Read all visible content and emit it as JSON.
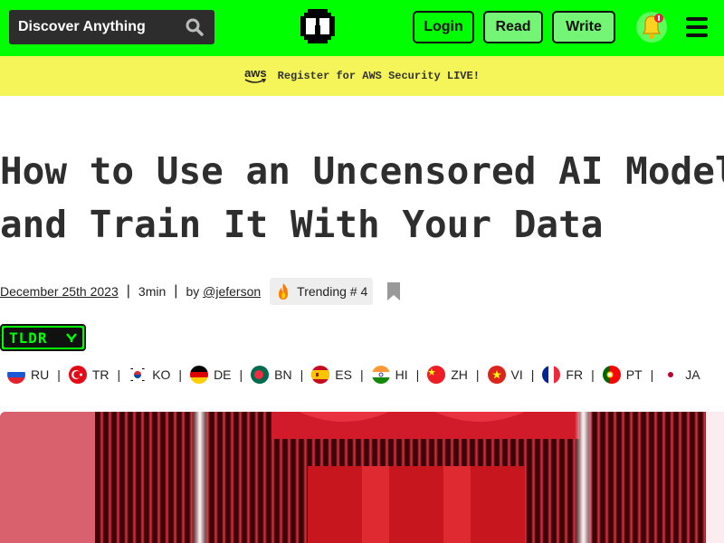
{
  "header": {
    "search_label": "Discover Anything",
    "search_icon": "search-icon",
    "logo_icon": "hackernoon-logo-icon",
    "login_label": "Login",
    "read_label": "Read",
    "write_label": "Write",
    "bell_icon": "bell-icon",
    "menu_icon": "menu-icon",
    "accent_color": "#00ff00"
  },
  "banner": {
    "brand": "aws",
    "text": "Register for AWS Security LIVE!",
    "color": "#f5f55a"
  },
  "article": {
    "title_line1": "How to Use an Uncensored AI Model",
    "title_line2": "and Train It With Your Data",
    "date": "December 25th 2023",
    "read_time": "3min",
    "by_prefix": "by",
    "author": "@jeferson",
    "trending": "Trending # 4",
    "tldr_label": "TLDR",
    "tldr_chevron": "chevron-down-icon"
  },
  "languages": [
    {
      "code": "RU",
      "flag": "russia-flag-icon"
    },
    {
      "code": "TR",
      "flag": "turkey-flag-icon"
    },
    {
      "code": "KO",
      "flag": "korea-flag-icon"
    },
    {
      "code": "DE",
      "flag": "germany-flag-icon"
    },
    {
      "code": "BN",
      "flag": "bangladesh-flag-icon"
    },
    {
      "code": "ES",
      "flag": "spain-flag-icon"
    },
    {
      "code": "HI",
      "flag": "india-flag-icon"
    },
    {
      "code": "ZH",
      "flag": "china-flag-icon"
    },
    {
      "code": "VI",
      "flag": "vietnam-flag-icon"
    },
    {
      "code": "FR",
      "flag": "france-flag-icon"
    },
    {
      "code": "PT",
      "flag": "portugal-flag-icon"
    },
    {
      "code": "JA",
      "flag": "japan-flag-icon"
    }
  ]
}
